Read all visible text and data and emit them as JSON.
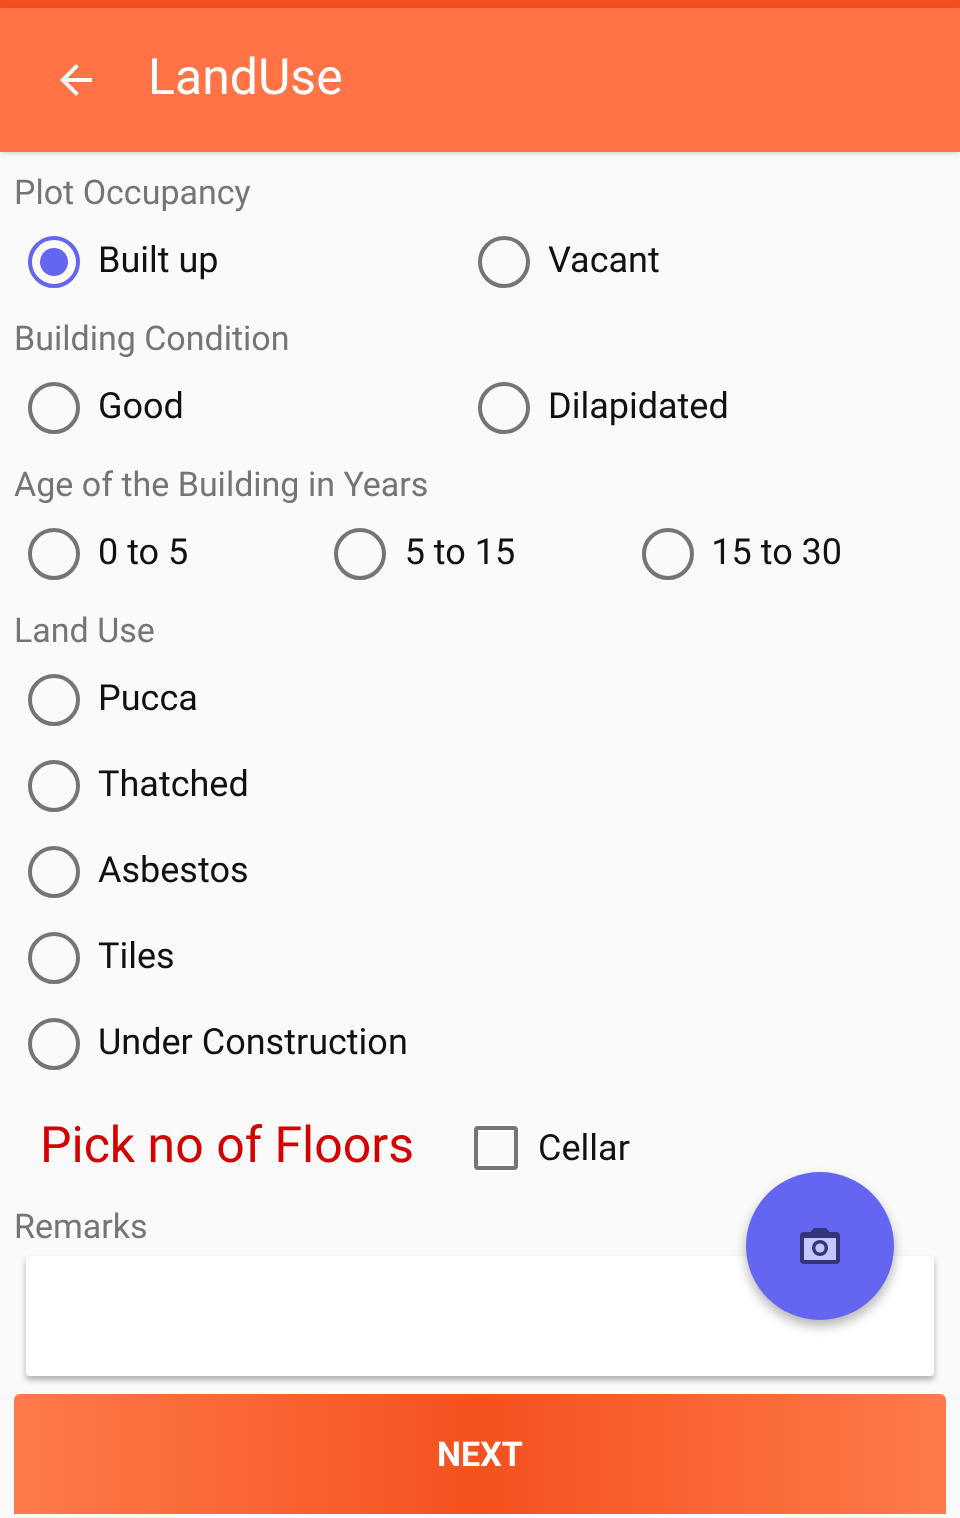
{
  "app_bar": {
    "title": "LandUse"
  },
  "groups": [
    {
      "label": "Plot Occupancy",
      "kind": "pair",
      "options": [
        {
          "label": "Built up",
          "selected": true
        },
        {
          "label": "Vacant",
          "selected": false
        }
      ]
    },
    {
      "label": "Building Condition",
      "kind": "pair",
      "options": [
        {
          "label": "Good",
          "selected": false
        },
        {
          "label": "Dilapidated",
          "selected": false
        }
      ]
    },
    {
      "label": "Age of the Building in Years",
      "kind": "triple",
      "options": [
        {
          "label": "0 to 5",
          "selected": false
        },
        {
          "label": "5 to 15",
          "selected": false
        },
        {
          "label": "15 to 30",
          "selected": false
        }
      ]
    },
    {
      "label": "Land Use",
      "kind": "list",
      "options": [
        {
          "label": "Pucca",
          "selected": false
        },
        {
          "label": "Thatched",
          "selected": false
        },
        {
          "label": "Asbestos",
          "selected": false
        },
        {
          "label": "Tiles",
          "selected": false
        },
        {
          "label": "Under Construction",
          "selected": false
        }
      ]
    }
  ],
  "floors_link": "Pick no of Floors",
  "cellar": {
    "label": "Cellar",
    "checked": false
  },
  "remarks": {
    "label": "Remarks"
  },
  "next_button": "NEXT"
}
